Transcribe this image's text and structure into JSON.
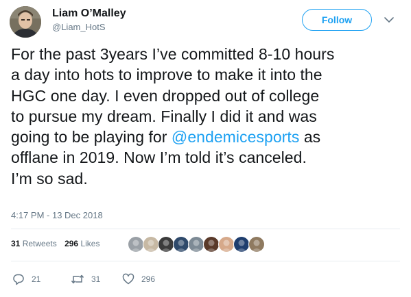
{
  "author": {
    "display_name": "Liam O’Malley",
    "handle": "@Liam_HotS"
  },
  "header": {
    "follow_label": "Follow"
  },
  "tweet": {
    "lines": [
      "For the past 3years I’ve committed 8-10 hours",
      "a day into hots to improve to make it into the",
      "HGC one day. I even dropped out of college",
      "to pursue my dream. Finally I did it and was"
    ],
    "line5_before": "going to be playing for ",
    "line5_mention": "@endemicesports",
    "line5_after": " as",
    "line6": "offlane in 2019. Now I’m told it’s canceled.",
    "line7": "I’m so sad.",
    "timestamp": "4:17 PM - 13 Dec 2018"
  },
  "stats": {
    "retweets_count": "31",
    "retweets_label": "Retweets",
    "likes_count": "296",
    "likes_label": "Likes"
  },
  "likers": [
    {
      "icon": "avatar-1",
      "color": "#9aa0a6"
    },
    {
      "icon": "avatar-2",
      "color": "#c7b9a4"
    },
    {
      "icon": "avatar-3",
      "color": "#3b3b3b"
    },
    {
      "icon": "avatar-4",
      "color": "#2f4a6b"
    },
    {
      "icon": "avatar-5",
      "color": "#7d8a95"
    },
    {
      "icon": "avatar-6",
      "color": "#5a3a2a"
    },
    {
      "icon": "avatar-7",
      "color": "#d6a98a"
    },
    {
      "icon": "avatar-8",
      "color": "#1f3e6e"
    },
    {
      "icon": "avatar-9",
      "color": "#8f7a60"
    }
  ],
  "actions": {
    "reply_count": "21",
    "retweet_count": "31",
    "like_count": "296"
  },
  "colors": {
    "accent": "#1da1f2",
    "text": "#14171a",
    "secondary": "#657786",
    "divider": "#e6ecf0"
  }
}
